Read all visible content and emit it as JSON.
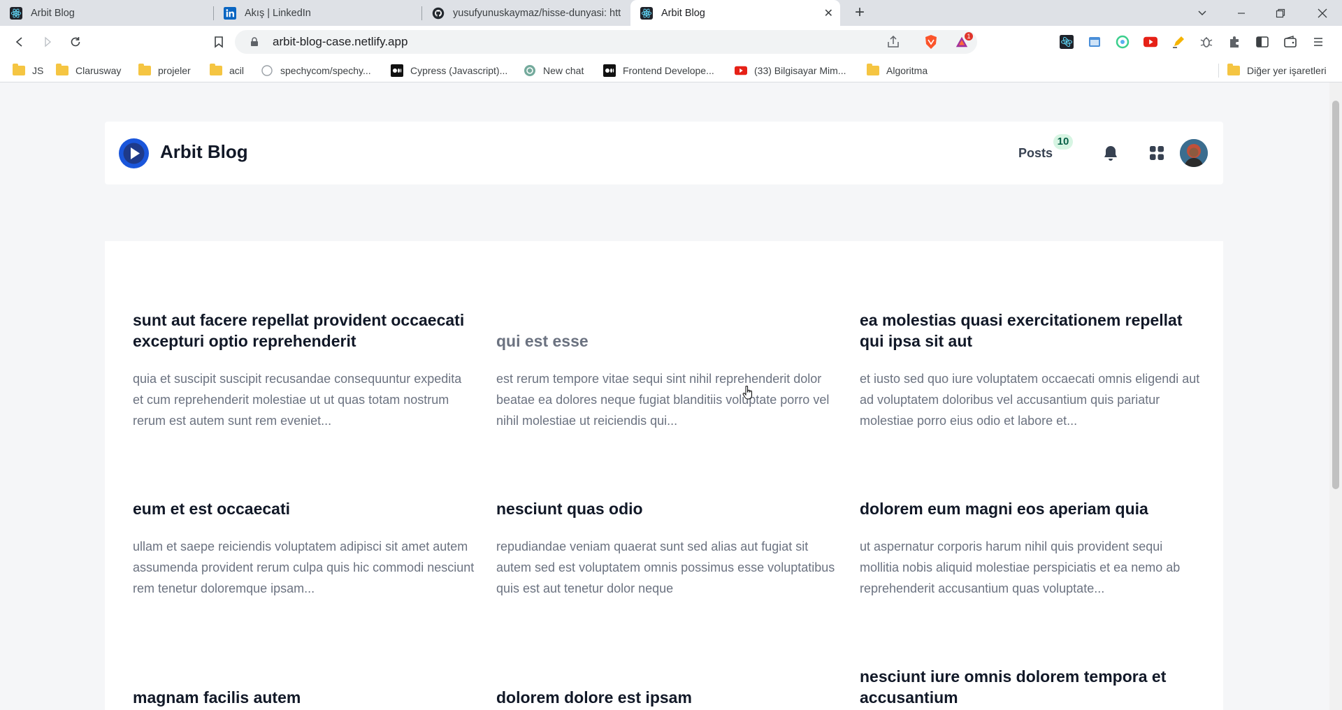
{
  "browser": {
    "tabs": [
      {
        "title": "Arbit Blog",
        "icon": "react-icon"
      },
      {
        "title": "Akış | LinkedIn",
        "icon": "linkedin-icon"
      },
      {
        "title": "yusufyunuskaymaz/hisse-dunyasi: http",
        "icon": "github-icon"
      },
      {
        "title": "Arbit Blog",
        "icon": "react-icon",
        "active": true
      }
    ],
    "url": "arbit-blog-case.netlify.app",
    "bookmarks": [
      {
        "label": "JS",
        "icon": "folder-icon"
      },
      {
        "label": "Clarusway",
        "icon": "folder-icon"
      },
      {
        "label": "projeler",
        "icon": "folder-icon"
      },
      {
        "label": "acil",
        "icon": "folder-icon"
      },
      {
        "label": "spechycom/spechy...",
        "icon": "github-icon"
      },
      {
        "label": "Cypress (Javascript)...",
        "icon": "medium-icon"
      },
      {
        "label": "New chat",
        "icon": "openai-icon"
      },
      {
        "label": "Frontend Develope...",
        "icon": "medium-icon"
      },
      {
        "label": "(33) Bilgisayar Mim...",
        "icon": "youtube-icon"
      },
      {
        "label": "Algoritma",
        "icon": "folder-icon"
      }
    ],
    "other_bookmarks": "Diğer yer işaretleri",
    "brave_badge": "1"
  },
  "header": {
    "brand": "Arbit Blog",
    "posts_label": "Posts",
    "posts_count": "10"
  },
  "posts": [
    {
      "title": "sunt aut facere repellat provident occaecati excepturi optio reprehenderit",
      "body": "quia et suscipit suscipit recusandae consequuntur expedita et cum reprehenderit molestiae ut ut quas totam nostrum rerum est autem sunt rem eveniet..."
    },
    {
      "title": "qui est esse",
      "body": "est rerum tempore vitae sequi sint nihil reprehenderit dolor beatae ea dolores neque fugiat blanditiis voluptate porro vel nihil molestiae ut reiciendis qui..."
    },
    {
      "title": "ea molestias quasi exercitationem repellat qui ipsa sit aut",
      "body": "et iusto sed quo iure voluptatem occaecati omnis eligendi aut ad voluptatem doloribus vel accusantium quis pariatur molestiae porro eius odio et labore et..."
    },
    {
      "title": "eum et est occaecati",
      "body": "ullam et saepe reiciendis voluptatem adipisci sit amet autem assumenda provident rerum culpa quis hic commodi nesciunt rem tenetur doloremque ipsam..."
    },
    {
      "title": "nesciunt quas odio",
      "body": "repudiandae veniam quaerat sunt sed alias aut fugiat sit autem sed est voluptatem omnis possimus esse voluptatibus quis est aut tenetur dolor neque"
    },
    {
      "title": "dolorem eum magni eos aperiam quia",
      "body": "ut aspernatur corporis harum nihil quis provident sequi mollitia nobis aliquid molestiae perspiciatis et ea nemo ab reprehenderit accusantium quas voluptate..."
    },
    {
      "title": "magnam facilis autem",
      "body": ""
    },
    {
      "title": "dolorem dolore est ipsam",
      "body": ""
    },
    {
      "title": "nesciunt iure omnis dolorem tempora et accusantium",
      "body": ""
    }
  ],
  "colors": {
    "brand_blue": "#1a56db",
    "badge_bg": "#d7f5e3",
    "title": "#111827",
    "muted": "#6b7280"
  }
}
